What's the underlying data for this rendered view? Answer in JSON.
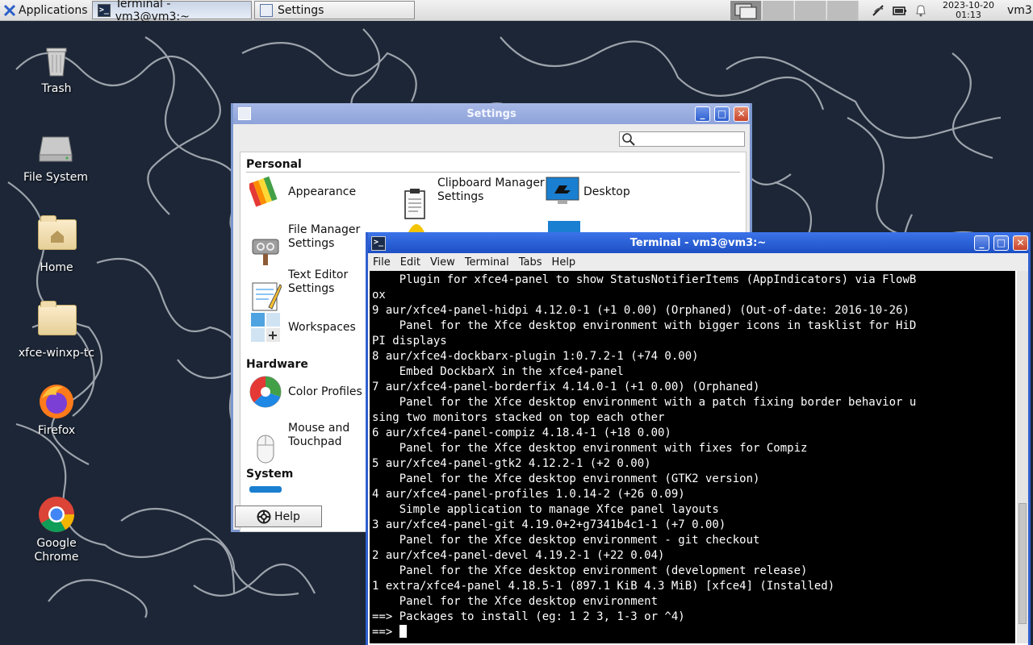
{
  "panel": {
    "applications_label": "Applications",
    "tasks": [
      {
        "label": "Terminal - vm3@vm3:~",
        "icon": "terminal-icon"
      },
      {
        "label": "Settings",
        "icon": "settings-icon"
      }
    ],
    "clock_date": "2023-10-20",
    "clock_time": "01:13",
    "user": "vm3"
  },
  "desktop": {
    "icons": [
      {
        "label": "Trash",
        "icon": "trash-icon"
      },
      {
        "label": "File System",
        "icon": "drive-icon"
      },
      {
        "label": "Home",
        "icon": "home-folder-icon"
      },
      {
        "label": "xfce-winxp-tc",
        "icon": "folder-icon"
      },
      {
        "label": "Firefox",
        "icon": "firefox-icon"
      },
      {
        "label": "Google\nChrome",
        "icon": "chrome-icon"
      }
    ]
  },
  "settings": {
    "title": "Settings",
    "categories": {
      "personal": "Personal",
      "hardware": "Hardware",
      "system": "System"
    },
    "items": {
      "appearance": "Appearance",
      "clipboard": "Clipboard Manager\nSettings",
      "desktop": "Desktop",
      "file_manager": "File Manager\nSettings",
      "text_editor": "Text Editor\nSettings",
      "workspaces": "Workspaces",
      "color_profiles": "Color Profiles",
      "mouse": "Mouse and\nTouchpad"
    },
    "help_label": "Help"
  },
  "terminal": {
    "title": "Terminal - vm3@vm3:~",
    "menu": [
      "File",
      "Edit",
      "View",
      "Terminal",
      "Tabs",
      "Help"
    ],
    "lines": [
      "    Plugin for xfce4-panel to show StatusNotifierItems (AppIndicators) via FlowB",
      "ox",
      "9 aur/xfce4-panel-hidpi 4.12.0-1 (+1 0.00) (Orphaned) (Out-of-date: 2016-10-26)",
      "    Panel for the Xfce desktop environment with bigger icons in tasklist for HiD",
      "PI displays",
      "8 aur/xfce4-dockbarx-plugin 1:0.7.2-1 (+74 0.00)",
      "    Embed DockbarX in the xfce4-panel",
      "7 aur/xfce4-panel-borderfix 4.14.0-1 (+1 0.00) (Orphaned)",
      "    Panel for the Xfce desktop environment with a patch fixing border behavior u",
      "sing two monitors stacked on top each other",
      "6 aur/xfce4-panel-compiz 4.18.4-1 (+18 0.00)",
      "    Panel for the Xfce desktop environment with fixes for Compiz",
      "5 aur/xfce4-panel-gtk2 4.12.2-1 (+2 0.00)",
      "    Panel for the Xfce desktop environment (GTK2 version)",
      "4 aur/xfce4-panel-profiles 1.0.14-2 (+26 0.09)",
      "    Simple application to manage Xfce panel layouts",
      "3 aur/xfce4-panel-git 4.19.0+2+g7341b4c1-1 (+7 0.00)",
      "    Panel for the Xfce desktop environment - git checkout",
      "2 aur/xfce4-panel-devel 4.19.2-1 (+22 0.04)",
      "    Panel for the Xfce desktop environment (development release)",
      "1 extra/xfce4-panel 4.18.5-1 (897.1 KiB 4.3 MiB) [xfce4] (Installed)",
      "    Panel for the Xfce desktop environment",
      "==> Packages to install (eg: 1 2 3, 1-3 or ^4)"
    ],
    "prompt": "==> "
  }
}
